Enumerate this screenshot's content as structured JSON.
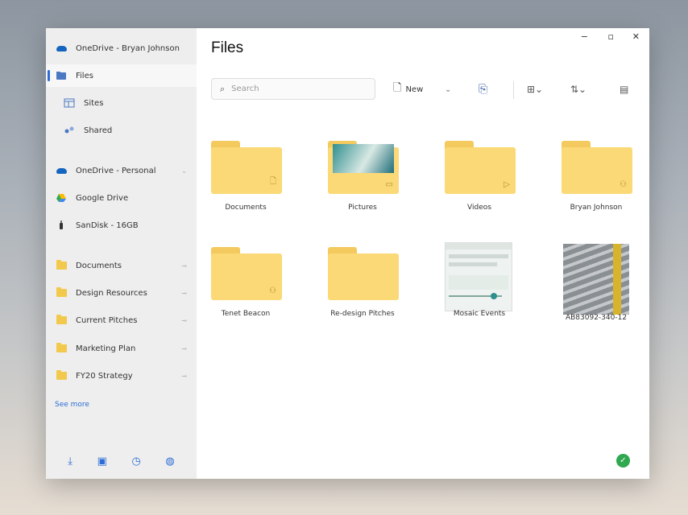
{
  "sidebar": {
    "accounts": [
      {
        "label": "OneDrive - Bryan Johnson",
        "icon": "onedrive-cloud-icon"
      }
    ],
    "nav": [
      {
        "label": "Files",
        "icon": "files-icon",
        "active": true
      },
      {
        "label": "Sites",
        "icon": "sites-icon"
      },
      {
        "label": "Shared",
        "icon": "shared-icon"
      }
    ],
    "drives": [
      {
        "label": "OneDrive - Personal",
        "icon": "onedrive-cloud-icon"
      },
      {
        "label": "Google Drive",
        "icon": "google-drive-icon"
      },
      {
        "label": "SanDisk - 16GB",
        "icon": "usb-drive-icon"
      }
    ],
    "pinned": [
      {
        "label": "Documents"
      },
      {
        "label": "Design Resources"
      },
      {
        "label": "Current Pitches"
      },
      {
        "label": "Marketing Plan"
      },
      {
        "label": "FY20 Strategy"
      }
    ],
    "see_more": "See more",
    "bottom_icons": [
      "download-icon",
      "clipboard-icon",
      "clock-icon",
      "globe-icon"
    ]
  },
  "main": {
    "title": "Files",
    "search_placeholder": "Search",
    "toolbar": {
      "new_label": "New"
    },
    "items": [
      {
        "label": "Documents",
        "type": "folder",
        "badge": "document-icon"
      },
      {
        "label": "Pictures",
        "type": "folder-image",
        "badge": "picture-icon"
      },
      {
        "label": "Videos",
        "type": "folder",
        "badge": "video-icon"
      },
      {
        "label": "Bryan Johnson",
        "type": "folder",
        "badge": "shared-people-icon"
      },
      {
        "label": "Tenet Beacon",
        "type": "folder",
        "badge": "shared-people-icon"
      },
      {
        "label": "Re-design Pitches",
        "type": "folder"
      },
      {
        "label": "Mosaic Events",
        "type": "screenshot"
      },
      {
        "label": "AB83092-340-12",
        "type": "photo"
      }
    ]
  },
  "colors": {
    "accent": "#2b6cd6",
    "folder": "#fad976",
    "sidebar_bg": "#eeeeee",
    "status_ok": "#2fa84f"
  }
}
